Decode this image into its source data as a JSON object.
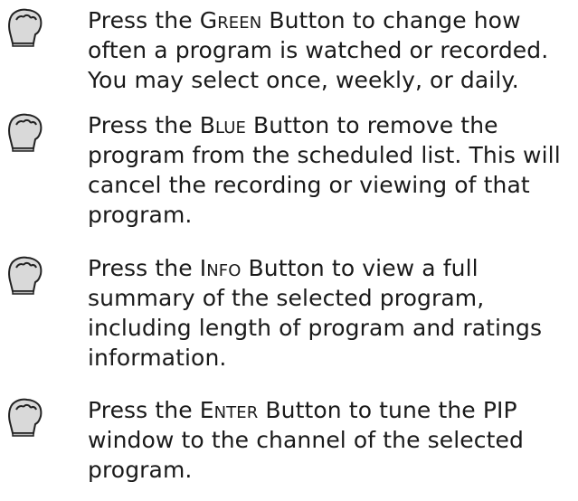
{
  "instructions": [
    {
      "icon": "pointing-hand-icon",
      "prefix": "Press the ",
      "button": "Green",
      "rest": " Button to change how often a program is watched or recorded. You may select once, weekly, or daily."
    },
    {
      "icon": "pointing-hand-icon",
      "prefix": "Press the ",
      "button": "Blue",
      "rest": " Button to remove the program from the scheduled list. This will cancel the recording or viewing of that program."
    },
    {
      "icon": "pointing-hand-icon",
      "prefix": "Press the ",
      "button": "Info",
      "rest": " Button to view a full summary of the selected program, including length of program and ratings information."
    },
    {
      "icon": "pointing-hand-icon",
      "prefix": "Press the ",
      "button": "Enter",
      "rest": " Button to tune the PIP window to the channel of the selected program."
    }
  ],
  "colors": {
    "text": "#1a1a1a",
    "icon_fill": "#d9d9d9",
    "icon_stroke": "#222222"
  }
}
